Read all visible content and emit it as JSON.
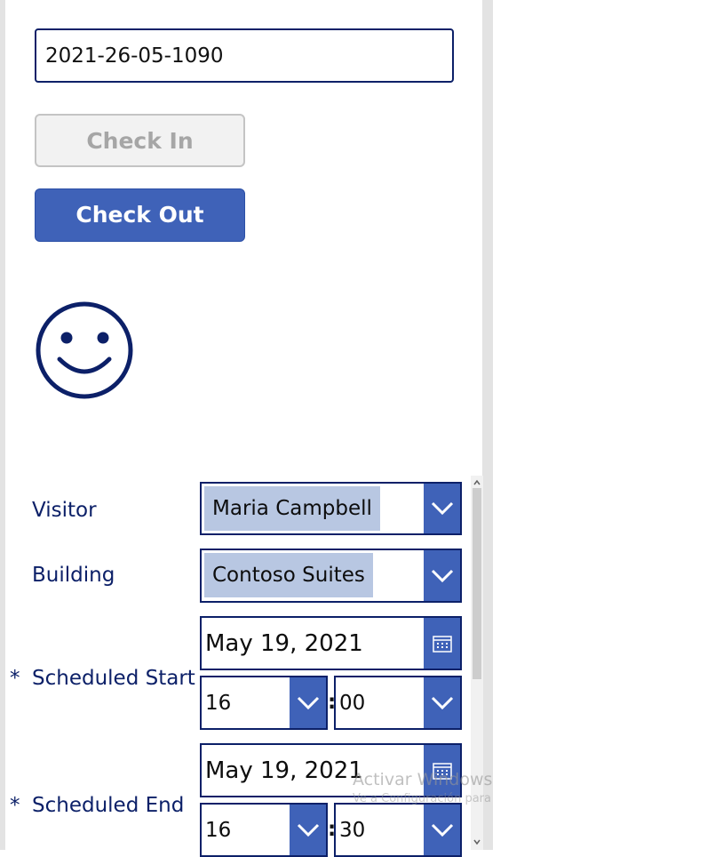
{
  "record": {
    "id_value": "2021-26-05-1090"
  },
  "actions": {
    "check_in_label": "Check In",
    "check_out_label": "Check Out"
  },
  "form": {
    "visitor": {
      "label": "Visitor",
      "value": "Maria Campbell"
    },
    "building": {
      "label": "Building",
      "value": "Contoso Suites"
    },
    "scheduled_start": {
      "required_mark": "*",
      "label": "Scheduled Start",
      "date": "May 19, 2021",
      "hour": "16",
      "minute": "00"
    },
    "scheduled_end": {
      "required_mark": "*",
      "label": "Scheduled End",
      "date": "May 19, 2021",
      "hour": "16",
      "minute": "30"
    },
    "time_separator": ":"
  },
  "watermark": {
    "line1": "Activar Windows",
    "line2": "Ve a Configuración para activar Windows."
  },
  "colors": {
    "accent": "#3f62b8",
    "navy": "#0c2068",
    "selection": "#b8c7e2",
    "disabled_bg": "#f2f2f2",
    "disabled_text": "#a6a6a6"
  }
}
